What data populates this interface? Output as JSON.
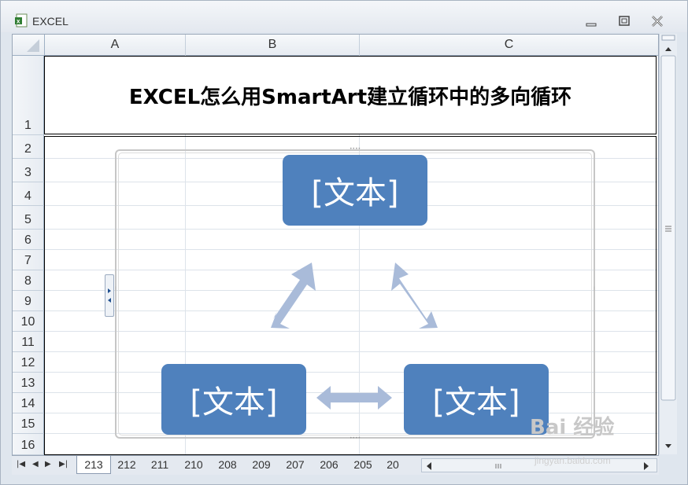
{
  "window": {
    "title": "EXCEL"
  },
  "columns": [
    "A",
    "B",
    "C"
  ],
  "rows": [
    "1",
    "2",
    "3",
    "4",
    "5",
    "6",
    "7",
    "8",
    "9",
    "10",
    "11",
    "12",
    "13",
    "14",
    "15",
    "16"
  ],
  "cell_A1": "EXCEL怎么用SmartArt建立循环中的多向循环",
  "smartart": {
    "nodes": [
      "[文本]",
      "[文本]",
      "[文本]"
    ],
    "node_color": "#4f81bd",
    "arrow_color": "#a9bbd9"
  },
  "sheet_tabs": [
    "213",
    "212",
    "211",
    "210",
    "208",
    "209",
    "207",
    "206",
    "205",
    "20"
  ],
  "active_tab": "213",
  "watermark": {
    "brand": "Bai 经验",
    "url": "jingyan.baidu.com"
  }
}
